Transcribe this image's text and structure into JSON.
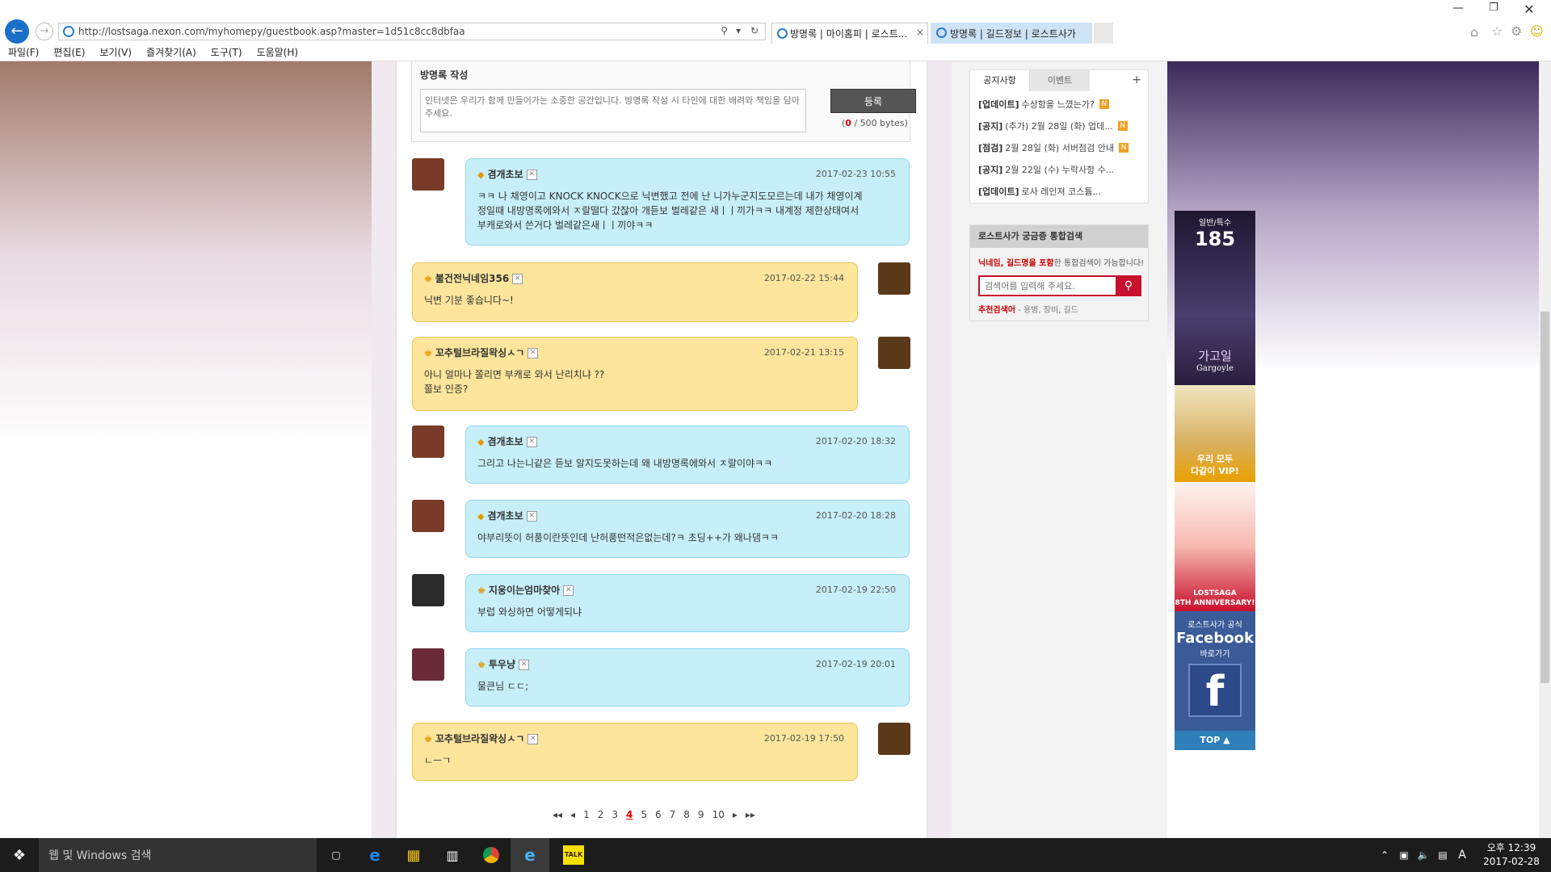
{
  "browser": {
    "url": "http://lostsaga.nexon.com/myhomepy/guestbook.asp?master=1d51c8cc8dbfaa",
    "tabs": [
      {
        "label": "방명록 | 마이홈피 | 로스트..."
      },
      {
        "label": "방명록 | 길드정보 | 로스트사가"
      }
    ],
    "menu": [
      "파일(F)",
      "편집(E)",
      "보기(V)",
      "즐겨찾기(A)",
      "도구(T)",
      "도움말(H)"
    ]
  },
  "guestbook": {
    "title": "방명록 작성",
    "placeholder": "인터넷은 우리가 함께 만들어가는 소중한 공간입니다. 방명록 작성 시 타인에 대한 배려와 책임을 담아주세요.",
    "submit_label": "등록",
    "count": "0",
    "count_suffix": " / 500 bytes)",
    "count_prefix": "("
  },
  "entries": [
    {
      "name": "겸개초보",
      "date": "2017-02-23 10:55",
      "msg": "ㅋㅋ 나 채영이고 KNOCK KNOCK으로 닉변했고 전에 난 니가누군지도모르는데 내가 채영이계\n정일때 내방명록에와서 ㅈ랄떨다 갔잖아 개듣보 벌레같은 새ㅣㅣ끼가ㅋㅋ 내계정 제한상태여서\n부캐로와서 쓴거다 벌레같은새ㅣㅣ끼야ㅋㅋ"
    },
    {
      "name": "불건전닉네임356",
      "date": "2017-02-22 15:44",
      "msg": "닉변 기분 좋습니다~!"
    },
    {
      "name": "꼬추털브라질왁싱ㅅㄱ",
      "date": "2017-02-21 13:15",
      "msg": "아니 얼마나 쫄리면 부캐로 와서 난리치냐 ??\n쫄보 인증?"
    },
    {
      "name": "겸개초보",
      "date": "2017-02-20 18:32",
      "msg": "그리고 나는니같은 듣보 알지도못하는데 왜 내방명록에와서 ㅈ랄이야ㅋㅋ"
    },
    {
      "name": "겸개초보",
      "date": "2017-02-20 18:28",
      "msg": "야부리뜻이 허풍이란뜻인데 난허풍떤적은없는데?ㅋ 초딩++가 왜나댐ㅋㅋ"
    },
    {
      "name": "지웅이는엄마찾아",
      "date": "2017-02-19 22:50",
      "msg": "부럽 와싱하면 어떻게되냐"
    },
    {
      "name": "투우냥",
      "date": "2017-02-19 20:01",
      "msg": "물큰님 ㄷㄷ;"
    },
    {
      "name": "꼬추털브라질왁싱ㅅㄱ",
      "date": "2017-02-19 17:50",
      "msg": "ㄴㅡㄱ"
    }
  ],
  "pager": {
    "first": "◂◂",
    "prev": "◂",
    "pages": [
      "1",
      "2",
      "3",
      "4",
      "5",
      "6",
      "7",
      "8",
      "9",
      "10"
    ],
    "current": "4",
    "next": "▸",
    "last": "▸▸"
  },
  "sidebar": {
    "tab_notice": "공지사항",
    "tab_event": "이벤트",
    "plus": "+",
    "notices": [
      {
        "tag": "[업데이트]",
        "text": "수상함을 느꼈는가?",
        "new": true
      },
      {
        "tag": "[공지]",
        "text": "(추가) 2월 28일 (화) 업데...",
        "new": true
      },
      {
        "tag": "[점검]",
        "text": "2월 28일 (화) 서버점검 안내",
        "new": true
      },
      {
        "tag": "[공지]",
        "text": "2월 22일 (수) 누락사항 수...",
        "new": false
      },
      {
        "tag": "[업데이트]",
        "text": "로사 레인져 코스튬...",
        "new": false
      }
    ],
    "search_title": "로스트사가 궁금증 통합검색",
    "search_desc_red": "닉네임, 길드명을 포함",
    "search_desc": "한 통합검색이 가능합니다!",
    "search_placeholder": "검색어를 입력해 주세요.",
    "recommend_label": "추천검색어",
    "recommend": " - 용병, 장비, 길드"
  },
  "banner": {
    "top_tag": "일반/특수",
    "top_num": "185",
    "hero_name": "가고일",
    "hero_en": "Gargoyle",
    "vip": "우리 모두\n다같이 VIP!",
    "anniv": "LOSTSAGA\n8TH ANNIVERSARY!",
    "fb_label": "로스트사가 공식",
    "fb_brand": "Facebook",
    "fb_go": "바로가기",
    "top_btn": "TOP ▲"
  },
  "taskbar": {
    "search_placeholder": "웹 및 Windows 검색",
    "time": "오후 12:39",
    "date": "2017-02-28",
    "ime": "A"
  }
}
